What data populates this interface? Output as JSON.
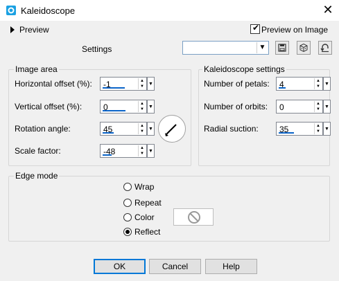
{
  "window": {
    "title": "Kaleidoscope",
    "close_glyph": "✕"
  },
  "preview": {
    "label": "Preview",
    "preview_on_image_label": "Preview on Image",
    "preview_on_image_checked": true
  },
  "settings": {
    "label": "Settings",
    "combo_value": "",
    "icons": [
      "save-icon",
      "dice-randomize-icon",
      "reset-icon"
    ]
  },
  "image_area": {
    "title": "Image area",
    "horizontal_offset": {
      "label": "Horizontal offset (%):",
      "value": "-1"
    },
    "vertical_offset": {
      "label": "Vertical offset (%):",
      "value": "0"
    },
    "rotation_angle": {
      "label": "Rotation angle:",
      "value": "45"
    },
    "scale_factor": {
      "label": "Scale factor:",
      "value": "-48"
    }
  },
  "kaleidoscope_settings": {
    "title": "Kaleidoscope settings",
    "number_of_petals": {
      "label": "Number of petals:",
      "value": "4"
    },
    "number_of_orbits": {
      "label": "Number of orbits:",
      "value": "0"
    },
    "radial_suction": {
      "label": "Radial suction:",
      "value": "35"
    }
  },
  "edge_mode": {
    "title": "Edge mode",
    "options": [
      "Wrap",
      "Repeat",
      "Color",
      "Reflect"
    ],
    "selected": "Reflect"
  },
  "buttons": {
    "ok": "OK",
    "cancel": "Cancel",
    "help": "Help"
  },
  "colors": {
    "accent": "#0078d7",
    "bar": "#0a64c8",
    "app_icon": "#1ba1e2"
  }
}
